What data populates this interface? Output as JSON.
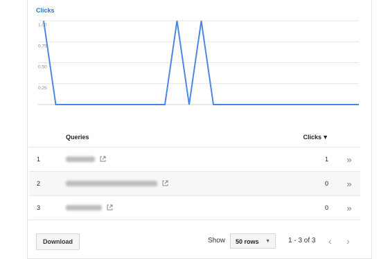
{
  "chart": {
    "legend": "Clicks",
    "color": "#4a86e8"
  },
  "chart_data": {
    "type": "line",
    "title": "",
    "series": [
      {
        "name": "Clicks",
        "values": [
          1,
          0,
          0,
          0,
          0,
          0,
          0,
          0,
          0,
          0,
          0,
          1,
          0,
          1,
          0,
          0,
          0,
          0,
          0,
          0,
          0,
          0,
          0,
          0,
          0,
          0,
          0
        ]
      }
    ],
    "y_ticks": [
      "1.00",
      "0.75",
      "0.50",
      "0.25"
    ],
    "ylim": [
      0,
      1
    ],
    "grid": true
  },
  "table": {
    "headers": {
      "queries": "Queries",
      "clicks": "Clicks"
    },
    "rows": [
      {
        "index": "1",
        "query": "",
        "clicks": "1"
      },
      {
        "index": "2",
        "query": "",
        "clicks": "0"
      },
      {
        "index": "3",
        "query": "",
        "clicks": "0"
      }
    ]
  },
  "footer": {
    "download": "Download",
    "show": "Show",
    "rows_option": "50 rows",
    "range": "1 - 3 of 3"
  }
}
